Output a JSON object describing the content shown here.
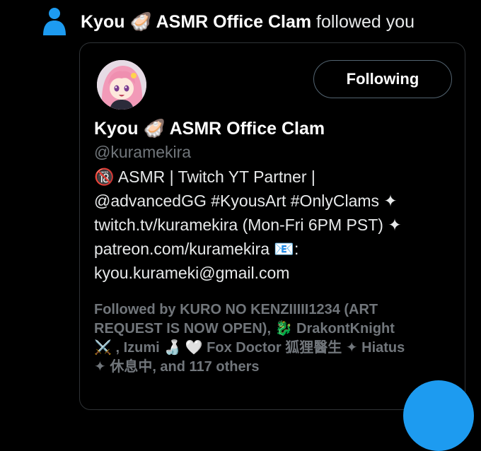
{
  "notification": {
    "name": "Kyou 🦪 ASMR Office Clam",
    "action": "followed you",
    "icon": "person-icon"
  },
  "card": {
    "follow_button_label": "Following",
    "display_name": "Kyou 🦪 ASMR Office Clam",
    "handle": "@kuramekira",
    "bio_lines": [
      "🔞 ASMR | Twitch YT Partner |",
      "@advancedGG #KyousArt #OnlyClams ✦",
      "twitch.tv/kuramekira (Mon-Fri 6PM PST) ✦",
      "patreon.com/kuramekira 📧:",
      "kyou.kurameki@gmail.com"
    ],
    "followed_by_lines": [
      "Followed by KURO NO KENZIIIII1234 (ART",
      "REQUEST IS NOW OPEN), 🐉 DrakontKnight",
      "⚔️ , Izumi 🍶 🤍  Fox Doctor 狐狸醫生 ✦ Hiatus",
      "✦ 休息中, and 117 others"
    ]
  },
  "colors": {
    "background": "#000000",
    "text": "#e7e9ea",
    "secondary_text": "#71767b",
    "border": "#2f3336",
    "accent": "#1d9bf0",
    "person_icon": "#1d9bf0"
  }
}
